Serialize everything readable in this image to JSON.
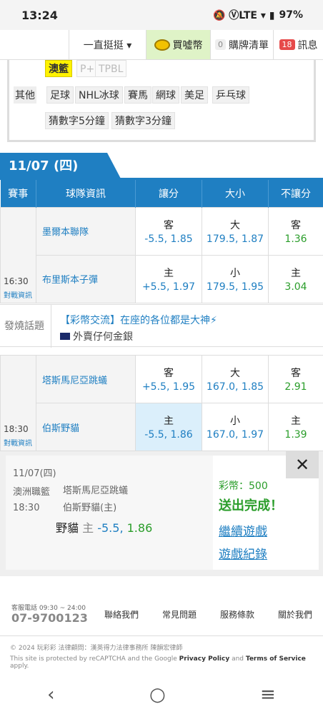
{
  "status": {
    "time": "13:24",
    "battery": "97%",
    "icons": "🔕 ⓋLTE ▾ ▮"
  },
  "topnav": {
    "menu_label": "一直挺挺 ▾",
    "buy_label": "買噓幣",
    "cart_count": "0",
    "cart_label": "購牌清單",
    "msg_count": "18",
    "msg_label": "訊息"
  },
  "filters": {
    "row1": [
      "澳籃",
      "P+",
      "TPBL"
    ],
    "other_label": "其他",
    "row2": [
      "足球",
      "NHL冰球",
      "賽馬",
      "網球",
      "美足",
      "乒乓球"
    ],
    "row3": [
      "猜數字5分鐘",
      "猜數字3分鐘"
    ]
  },
  "date": "11/07 (四)",
  "table_headers": [
    "賽事",
    "球隊資訊",
    "讓分",
    "大小",
    "不讓分"
  ],
  "games": [
    {
      "time": "16:30",
      "link": "對戰資訊",
      "rows": [
        {
          "team": "墨爾本聯隊",
          "spread_side": "客",
          "spread": "-5.5, 1.85",
          "total_side": "大",
          "total": "179.5, 1.87",
          "ml_side": "客",
          "ml": "1.36"
        },
        {
          "team": "布里斯本子彈",
          "spread_side": "主",
          "spread": "+5.5, 1.97",
          "total_side": "小",
          "total": "179.5, 1.95",
          "ml_side": "主",
          "ml": "3.04"
        }
      ]
    },
    {
      "time": "18:30",
      "link": "對戰資訊",
      "rows": [
        {
          "team": "塔斯馬尼亞跳蟻",
          "spread_side": "客",
          "spread": "+5.5, 1.95",
          "total_side": "大",
          "total": "167.0, 1.85",
          "ml_side": "客",
          "ml": "2.91"
        },
        {
          "team": "伯斯野貓",
          "spread_side": "主",
          "spread": "-5.5, 1.86",
          "total_side": "小",
          "total": "167.0, 1.97",
          "ml_side": "主",
          "ml": "1.39"
        }
      ]
    }
  ],
  "hot": {
    "label": "發燒話題",
    "title": "【彩幣交流】在座的各位都是大神⚡",
    "sub": "外賣仔何金銀"
  },
  "slip": {
    "date": "11/07(四)",
    "league": "澳洲職籃",
    "time": "18:30",
    "team1": "塔斯馬尼亞跳蟻",
    "team2": "伯斯野貓(主)",
    "pick_team": "野貓",
    "pick_side": "主",
    "pick_line": "-5.5,",
    "pick_odds": "1.86",
    "coins_label": "彩幣：500",
    "sent": "送出完成！",
    "continue": "繼續遊戲",
    "record": "遊戲紀錄",
    "close": "✕"
  },
  "footer": {
    "phone_label": "客服電話 09:30 ~ 24:00",
    "phone": "07-9700123",
    "links": [
      "聯絡我們",
      "常見問題",
      "服務條款",
      "關於我們"
    ],
    "copyright": "© 2024 玩彩彩  法律顧問：漢英得力法律事務所 陳韻宏律師",
    "recaptcha_pre": "This site is protected by reCAPTCHA and the Google ",
    "privacy": "Privacy Policy",
    "and": " and ",
    "terms": "Terms of Service",
    "apply": " apply."
  },
  "navbar": {
    "back": "‹",
    "home": "○",
    "recent": "≡"
  },
  "colors": {
    "accent": "#1f7fc2",
    "green": "#2a9d2a",
    "highlight": "#fff200"
  }
}
